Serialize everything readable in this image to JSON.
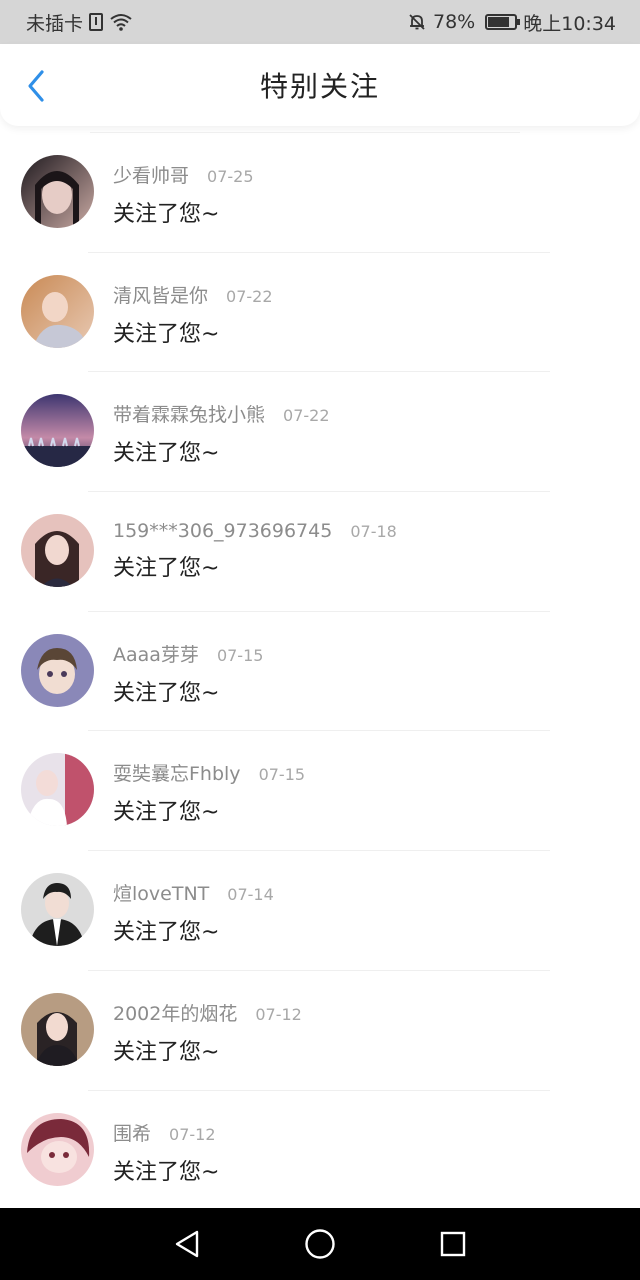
{
  "status_bar": {
    "carrier": "未插卡",
    "battery": "78%",
    "time": "晚上10:34"
  },
  "header": {
    "title": "特别关注",
    "back_icon": "chevron-left-icon",
    "accent": "#2f8fe8"
  },
  "items": [
    {
      "name": "少看帅哥",
      "date": "07-25",
      "message": "关注了您~",
      "avatar_colors": [
        "#1f1a1f",
        "#c9a9a3"
      ]
    },
    {
      "name": "清风皆是你",
      "date": "07-22",
      "message": "关注了您~",
      "avatar_colors": [
        "#c98a55",
        "#e8c9b3"
      ]
    },
    {
      "name": "带着霖霖兔找小熊",
      "date": "07-22",
      "message": "关注了您~",
      "avatar_colors": [
        "#3d3670",
        "#c48aa8"
      ]
    },
    {
      "name": "159***306_973696745",
      "date": "07-18",
      "message": "关注了您~",
      "avatar_colors": [
        "#3a2626",
        "#e6c2bd"
      ]
    },
    {
      "name": "Aaaa芽芽",
      "date": "07-15",
      "message": "关注了您~",
      "avatar_colors": [
        "#8a88b8",
        "#f1ddd2"
      ]
    },
    {
      "name": "耍奘曩忘Fhbly",
      "date": "07-15",
      "message": "关注了您~",
      "avatar_colors": [
        "#e8e2ea",
        "#c0526c"
      ]
    },
    {
      "name": "煊loveTNT",
      "date": "07-14",
      "message": "关注了您~",
      "avatar_colors": [
        "#dcdcdc",
        "#1e1e1e"
      ]
    },
    {
      "name": "2002年的烟花",
      "date": "07-12",
      "message": "关注了您~",
      "avatar_colors": [
        "#b79c82",
        "#2a2325"
      ]
    },
    {
      "name": "围希",
      "date": "07-12",
      "message": "关注了您~",
      "avatar_colors": [
        "#7a2a3a",
        "#f0ccd0"
      ]
    }
  ],
  "nav_bar": {
    "back": "triangle-back-icon",
    "home": "circle-home-icon",
    "recents": "square-recents-icon"
  }
}
